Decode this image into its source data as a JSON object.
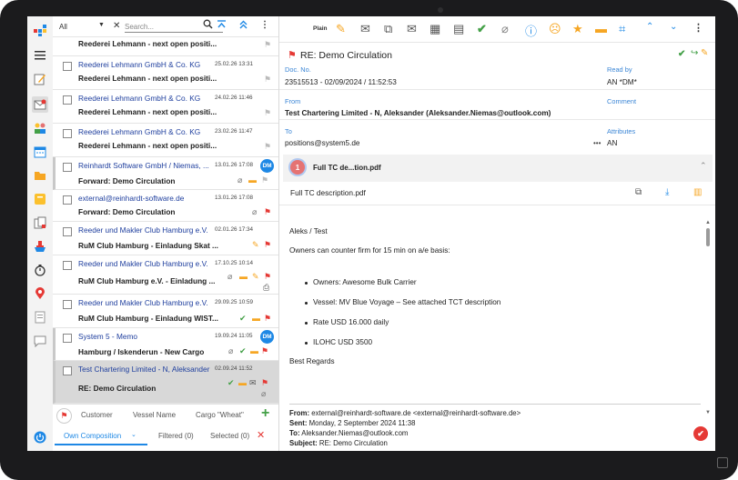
{
  "list": {
    "filter_value": "All",
    "search_placeholder": "Search...",
    "items": [
      {
        "sender": "",
        "subject": "Reederei Lehmann - next open positi...",
        "date": ""
      },
      {
        "sender": "Reederei Lehmann GmbH & Co. KG",
        "subject": "Reederei Lehmann - next open positi...",
        "date": "25.02.26 13:31"
      },
      {
        "sender": "Reederei Lehmann GmbH & Co. KG",
        "subject": "Reederei Lehmann - next open positi...",
        "date": "24.02.26 11:46"
      },
      {
        "sender": "Reederei Lehmann GmbH & Co. KG",
        "subject": "Reederei Lehmann - next open positi...",
        "date": "23.02.26 11:47"
      },
      {
        "sender": "Reinhardt Software GmbH / Niemas, ...",
        "subject": "Forward: Demo Circulation",
        "date": "13.01.26 17:08",
        "badge": "DM"
      },
      {
        "sender": "external@reinhardt-software.de",
        "subject": "Forward: Demo Circulation",
        "date": "13.01.26 17:08"
      },
      {
        "sender": "Reeder und Makler Club Hamburg e.V.",
        "subject": "RuM Club Hamburg - Einladung Skat ...",
        "date": "02.01.26 17:34"
      },
      {
        "sender": "Reeder und Makler Club Hamburg e.V.",
        "subject": "RuM Club Hamburg e.V. - Einladung ...",
        "date": "17.10.25 10:14"
      },
      {
        "sender": "Reeder und Makler Club Hamburg e.V.",
        "subject": "RuM Club Hamburg - Einladung WIST...",
        "date": "29.09.25 10:59"
      },
      {
        "sender": "System 5 - Memo",
        "subject": "Hamburg / Iskenderun - New Cargo",
        "date": "19.09.24 11:05",
        "badge": "DM"
      },
      {
        "sender": "Test Chartering Limited - N, Aleksander",
        "subject": "RE: Demo Circulation",
        "date": "02.09.24 11:52"
      }
    ],
    "columns": [
      "Customer",
      "Vessel Name",
      "Cargo \"Wheat\""
    ],
    "tabs": {
      "own": "Own Composition",
      "filtered": "Filtered (0)",
      "selected": "Selected (0)"
    }
  },
  "toolbar": {
    "plain_label": "Plain"
  },
  "message": {
    "title": "RE: Demo Circulation",
    "doc_no_label": "Doc. No.",
    "doc_no": "23515513 - 02/09/2024 / 11:52:53",
    "read_by_label": "Read by",
    "read_by": "AN *DM*",
    "from_label": "From",
    "from": "Test Chartering Limited - N, Aleksander (Aleksander.Niemas@outlook.com)",
    "comment_label": "Comment",
    "to_label": "To",
    "to": "positions@system5.de",
    "attributes_label": "Attributes",
    "attributes": "AN",
    "more": "•••",
    "attach_count": "1",
    "attach_header": "Full TC de...tion.pdf",
    "attach_file": "Full TC description.pdf"
  },
  "body": {
    "greeting": "Aleks / Test",
    "line1": "Owners can counter firm for 15 min on a/e basis:",
    "bullets": [
      "Owners: Awesome Bulk Carrier",
      "Vessel: MV Blue Voyage – See attached TCT description",
      "Rate USD 16.000 daily",
      "ILOHC USD 3500"
    ],
    "closing": "Best Regards",
    "quote_from_label": "From:",
    "quote_from": " external@reinhardt-software.de <external@reinhardt-software.de>",
    "quote_sent_label": "Sent:",
    "quote_sent": " Monday, 2 September 2024 11:38",
    "quote_to_label": "To:",
    "quote_to": " Aleksander.Niemas@outlook.com",
    "quote_subject_label": "Subject:",
    "quote_subject": " RE: Demo Circulation"
  },
  "colors": {
    "accent": "#1e88e5",
    "link": "#1f3f9e",
    "label": "#3b86d6",
    "flag": "#e53935",
    "check": "#43a047"
  }
}
